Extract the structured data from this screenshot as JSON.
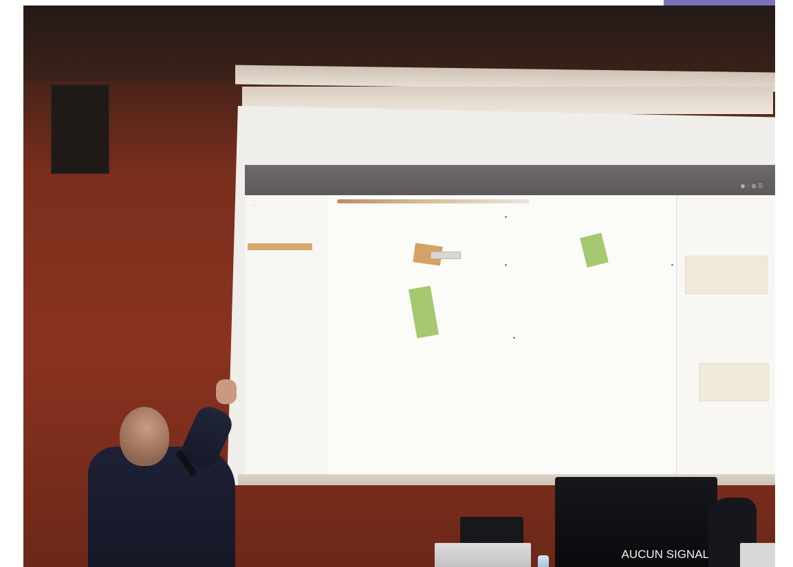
{
  "scene": {
    "caption_text": "AUCUN SIGNAL",
    "accent_colors": {
      "wall_red": "#8a3220",
      "screen_white": "#f4f3ef",
      "corner_block": "#7a73b8",
      "green_card": "#a5c870",
      "orange_card": "#d6a164"
    }
  }
}
